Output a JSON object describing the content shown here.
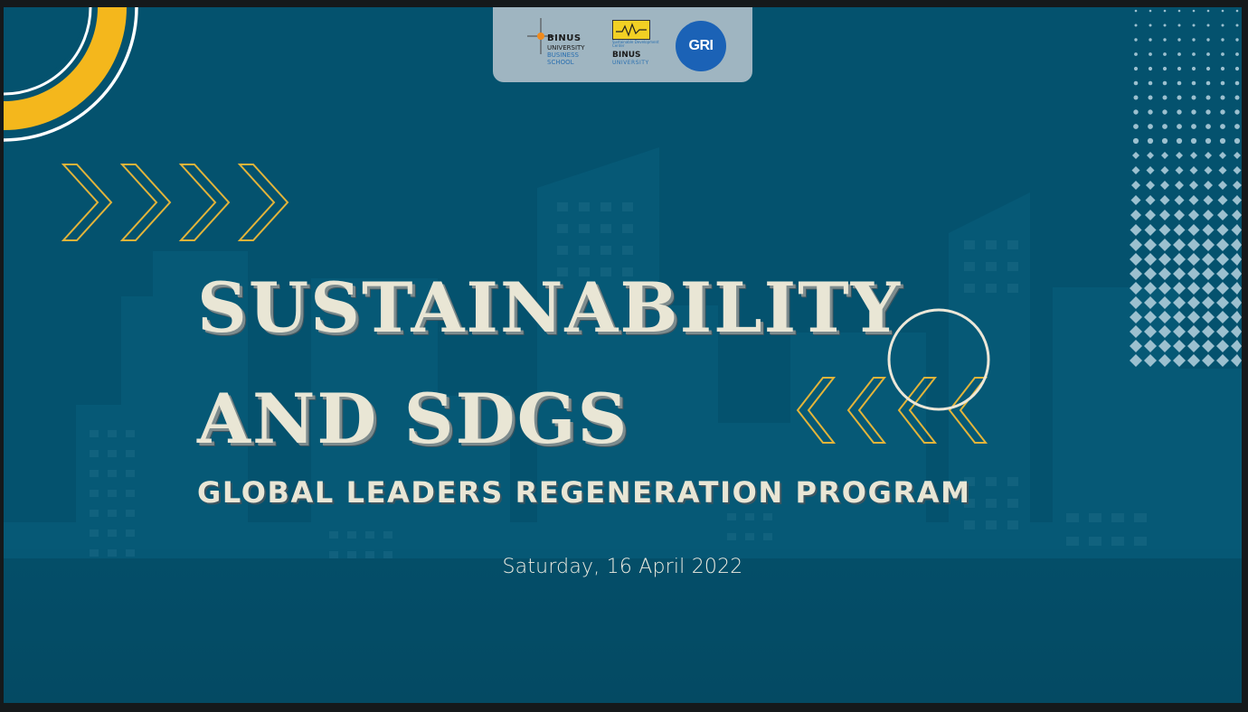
{
  "slide": {
    "title_line1": "SUSTAINABILITY",
    "title_line2": "AND SDGS",
    "subtitle": "GLOBAL LEADERS REGENERATION PROGRAM",
    "date": "Saturday, 16 April 2022"
  },
  "logos": {
    "binus_business_school": {
      "line1": "BINUS",
      "line2": "UNIVERSITY",
      "line3": "BUSINESS",
      "line4": "SCHOOL"
    },
    "binus_center": {
      "small": "Sustainable Development Center",
      "line1": "BINUS",
      "line2": "UNIVERSITY"
    },
    "gri": {
      "label": "GRI"
    }
  },
  "colors": {
    "background": "#04526e",
    "title_text": "#e9e6d5",
    "accent_yellow": "#f4b71c",
    "chevron_yellow": "#e2b43a",
    "logo_panel": "#9fb5c1",
    "gri_blue": "#1b62b6"
  },
  "icons": {
    "arrows_right": "chevron-right-icon",
    "arrows_left": "chevron-left-icon",
    "ring": "circle-outline-icon",
    "arc": "arc-decoration-icon",
    "dots": "dot-pattern-icon"
  }
}
